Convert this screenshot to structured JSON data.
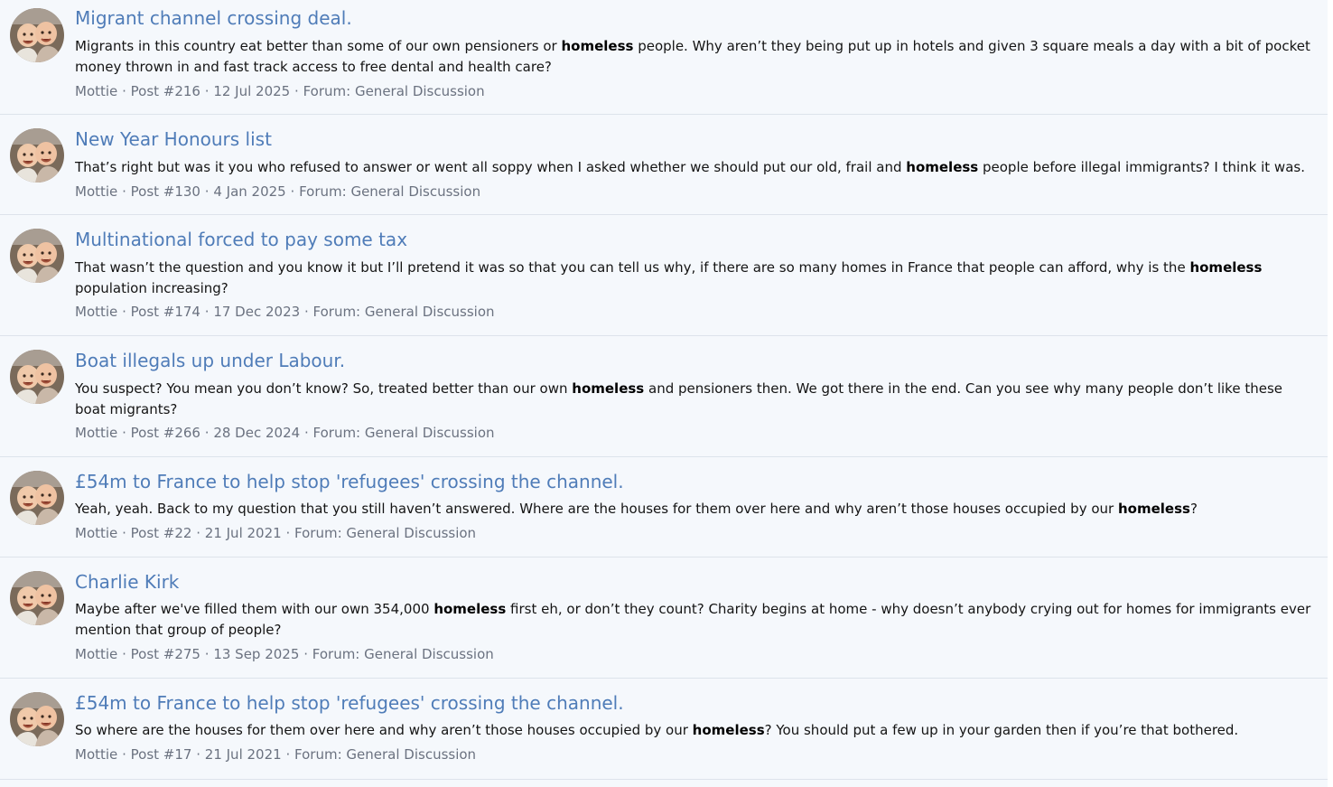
{
  "results": [
    {
      "title": "Migrant channel crossing deal.",
      "snippet_before": "Migrants in this country eat better than some of our own pensioners or ",
      "highlight": "homeless",
      "snippet_after": " people. Why aren’t they being put up in hotels and given 3 square meals a day with a bit of pocket money thrown in and fast track access to free dental and health care?",
      "author": "Mottie",
      "post": "Post #216",
      "date": "12 Jul 2025",
      "forum": "Forum: General Discussion",
      "sep": "·"
    },
    {
      "title": "New Year Honours list",
      "snippet_before": "That’s right but was it you who refused to answer or went all soppy when I asked whether we should put our old, frail and ",
      "highlight": "homeless",
      "snippet_after": " people before illegal immigrants? I think it was.",
      "author": "Mottie",
      "post": "Post #130",
      "date": "4 Jan 2025",
      "forum": "Forum: General Discussion",
      "sep": "·"
    },
    {
      "title": "Multinational forced to pay some tax",
      "snippet_before": "That wasn’t the question and you know it but I’ll pretend it was so that you can tell us why, if there are so many homes in France that people can afford, why is the ",
      "highlight": "homeless",
      "snippet_after": " population increasing?",
      "author": "Mottie",
      "post": "Post #174",
      "date": "17 Dec 2023",
      "forum": "Forum: General Discussion",
      "sep": "·"
    },
    {
      "title": "Boat illegals up under Labour.",
      "snippet_before": "You suspect? You mean you don’t know? So, treated better than our own ",
      "highlight": "homeless",
      "snippet_after": " and pensioners then. We got there in the end. Can you see why many people don’t like these boat migrants?",
      "author": "Mottie",
      "post": "Post #266",
      "date": "28 Dec 2024",
      "forum": "Forum: General Discussion",
      "sep": "·"
    },
    {
      "title": "£54m to France to help stop 'refugees' crossing the channel.",
      "snippet_before": "Yeah, yeah. Back to my question that you still haven’t answered. Where are the houses for them over here and why aren’t those houses occupied by our ",
      "highlight": "homeless",
      "snippet_after": "?",
      "author": "Mottie",
      "post": "Post #22",
      "date": "21 Jul 2021",
      "forum": "Forum: General Discussion",
      "sep": "·"
    },
    {
      "title": "Charlie Kirk",
      "snippet_before": "Maybe after we've filled them with our own 354,000 ",
      "highlight": "homeless",
      "snippet_after": " first eh, or don’t they count? Charity begins at home - why doesn’t anybody crying out for homes for immigrants ever mention that group of people?",
      "author": "Mottie",
      "post": "Post #275",
      "date": "13 Sep 2025",
      "forum": "Forum: General Discussion",
      "sep": "·"
    },
    {
      "title": "£54m to France to help stop 'refugees' crossing the channel.",
      "snippet_before": "So where are the houses for them over here and why aren’t those houses occupied by our ",
      "highlight": "homeless",
      "snippet_after": "? You should put a few up in your garden then if you’re that bothered.",
      "author": "Mottie",
      "post": "Post #17",
      "date": "21 Jul 2021",
      "forum": "Forum: General Discussion",
      "sep": "·"
    }
  ],
  "colors": {
    "title_link": "#4f7cb8",
    "meta_text": "#6b7280",
    "background": "#f5f8fc",
    "divider": "#dde3eb"
  },
  "icons": {
    "avatar": "avatar-photo-two-children"
  }
}
